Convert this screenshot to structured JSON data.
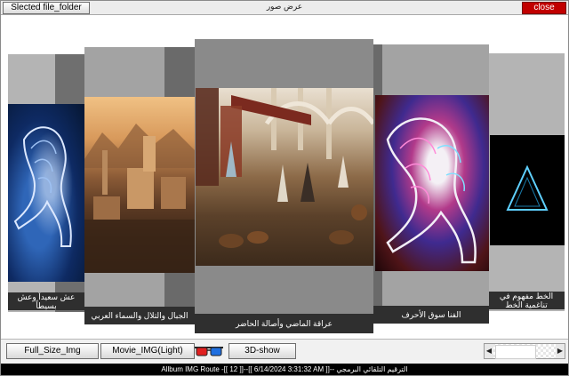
{
  "window": {
    "title": "عرض صور",
    "select_button": "Slected file_folder",
    "close_button": "close"
  },
  "cards": [
    {
      "caption": "عش سعيداً وعش بسيطاً",
      "art": "horse-blue-icon"
    },
    {
      "caption": "الجبال والتلال والسماء العربي",
      "art": "arab-city-icon"
    },
    {
      "caption": "عراقة الماضي وأصالة الحاضر",
      "art": "market-scene-icon"
    },
    {
      "caption": "الفنا سوق الأحرف",
      "art": "calligraphy-horse-icon"
    },
    {
      "caption": "الخط مفهوم في تناغمية الخط",
      "art": "triangle-icon"
    }
  ],
  "toolbar": {
    "full_size": "Full_Size_Img",
    "movie": "Movie_IMG(Light)",
    "show3d": "3D-show"
  },
  "status": {
    "text": "Allbum IMG Route -[[ 12 ]]--[[ 6/14/2024 3:31:32 AM ]]-- الترقيم التلقائي البرمجي"
  },
  "colors": {
    "close_red": "#c10000",
    "status_bg": "#000000",
    "card_gray": "#a3a3a3",
    "caption_bg": "#2f2f2f"
  }
}
